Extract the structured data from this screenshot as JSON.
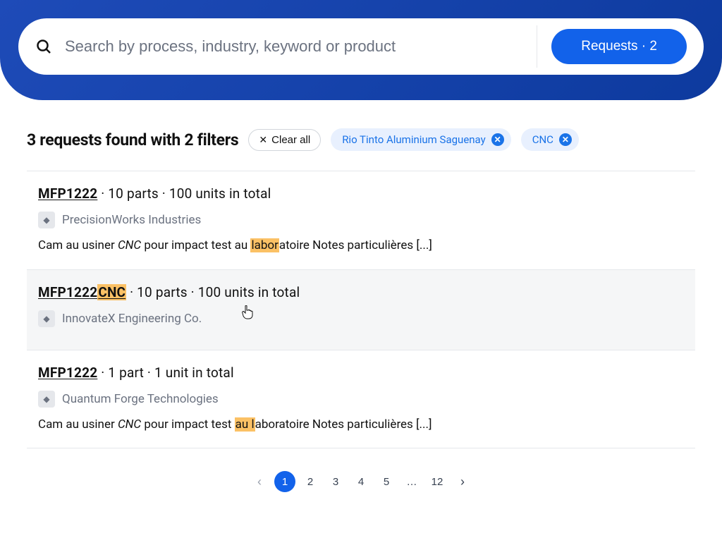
{
  "search": {
    "placeholder": "Search by process, industry, keyword or product",
    "button_label": "Requests · 2"
  },
  "filters": {
    "title": "3 requests found with 2 filters",
    "clear_label": "Clear all",
    "chips": [
      {
        "label": "Rio Tinto Aluminium Saguenay"
      },
      {
        "label": "CNC"
      }
    ]
  },
  "results": [
    {
      "id_pre": "MFP1222",
      "id_hl": "",
      "meta": " · 10 parts · 100 units in total",
      "company": "PrecisionWorks Industries",
      "desc_pre": "Cam au usiner ",
      "desc_em": "CNC",
      "desc_mid": " pour impact test au ",
      "desc_hl": "labor",
      "desc_post": "atoire Notes particulières [...]",
      "hovered": false,
      "has_desc": true
    },
    {
      "id_pre": "MFP1222",
      "id_hl": "CNC",
      "meta": " · 10 parts · 100 units in total",
      "company": "InnovateX Engineering Co.",
      "desc_pre": "",
      "desc_em": "",
      "desc_mid": "",
      "desc_hl": "",
      "desc_post": "",
      "hovered": true,
      "has_desc": false
    },
    {
      "id_pre": "MFP1222",
      "id_hl": "",
      "meta": " · 1 part · 1 unit in total",
      "company": "Quantum Forge Technologies",
      "desc_pre": "Cam au usiner ",
      "desc_em": "CNC",
      "desc_mid": " pour impact test ",
      "desc_hl": "au l",
      "desc_post": "aboratoire Notes particulières [...]",
      "hovered": false,
      "has_desc": true
    }
  ],
  "pagination": {
    "pages": [
      "1",
      "2",
      "3",
      "4",
      "5",
      "…",
      "12"
    ],
    "active": "1"
  }
}
